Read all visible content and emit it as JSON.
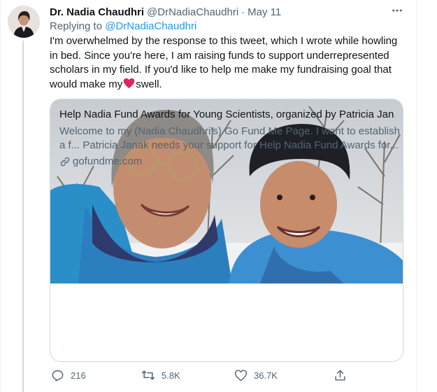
{
  "tweet": {
    "author_name": "Dr. Nadia Chaudhri",
    "author_handle": "@DrNadiaChaudhri",
    "separator": "·",
    "date": "May 11",
    "more_label": "···",
    "replying_prefix": "Replying to",
    "replying_handle": "@DrNadiaChaudhri",
    "text_lines": [
      "I'm overwhelmed by the response to this tweet, which I wrote while howling",
      "in bed. Since you're here, I am raising funds to support underrepresented",
      "scholars in my field. If you'd like to help me make my fundraising goal that"
    ],
    "text_last_before_emoji": "would make my",
    "text_last_after_emoji": "swell.",
    "emoji": "red-heart"
  },
  "card": {
    "title": "Help Nadia Fund Awards for Young Scientists, organized by Patricia Jan...",
    "desc_lines": [
      "Welcome to my (Nadia Chaudhri's) Go Fund Me Page. I want to establish",
      "a f... Patricia Janak needs your support for Help Nadia Fund Awards for..."
    ],
    "domain": "gofundme.com",
    "photo_icon": "selfie-photo"
  },
  "actions": {
    "reply_count": "216",
    "retweet_count": "5.8K",
    "like_count": "36.7K"
  },
  "colors": {
    "accent": "#1d9bf0",
    "heart": "#e0245e",
    "muted": "#536471",
    "text": "#0f1419"
  }
}
